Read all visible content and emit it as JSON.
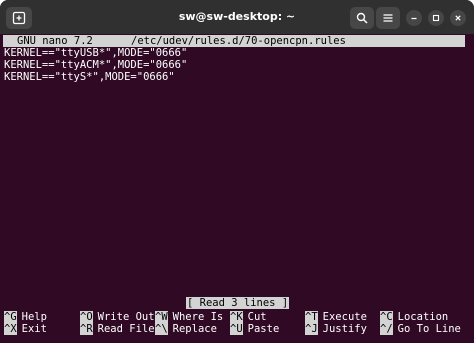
{
  "window": {
    "title": "sw@sw-desktop: ~"
  },
  "titlebar": {
    "icons": [
      "new-tab-icon",
      "search-icon",
      "hamburger-menu-icon",
      "minimize-icon",
      "maximize-icon",
      "close-icon"
    ]
  },
  "nano": {
    "version": "GNU nano 7.2",
    "filename": "/etc/udev/rules.d/70-opencpn.rules",
    "lines": [
      "KERNEL==\"ttyUSB*\",MODE=\"0666\"",
      "KERNEL==\"ttyACM*\",MODE=\"0666\"",
      "KERNEL==\"ttyS*\",MODE=\"0666\""
    ],
    "status": "[ Read 3 lines ]",
    "shortcuts": [
      {
        "key": "^G",
        "label": "Help"
      },
      {
        "key": "^O",
        "label": "Write Out"
      },
      {
        "key": "^W",
        "label": "Where Is"
      },
      {
        "key": "^K",
        "label": "Cut"
      },
      {
        "key": "^T",
        "label": "Execute"
      },
      {
        "key": "^C",
        "label": "Location"
      },
      {
        "key": "^X",
        "label": "Exit"
      },
      {
        "key": "^R",
        "label": "Read File"
      },
      {
        "key": "^\\",
        "label": "Replace"
      },
      {
        "key": "^U",
        "label": "Paste"
      },
      {
        "key": "^J",
        "label": "Justify"
      },
      {
        "key": "^/",
        "label": "Go To Line"
      }
    ]
  },
  "colors": {
    "terminal_bg": "#300a24",
    "titlebar_bg": "#303030",
    "highlight_bg": "#d3d3d3"
  }
}
